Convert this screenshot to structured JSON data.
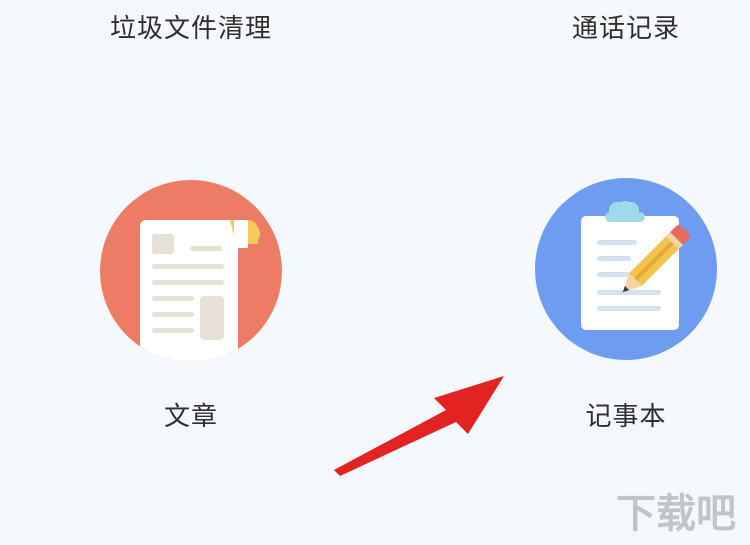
{
  "grid": {
    "items": [
      {
        "label": "垃圾文件清理",
        "icon": "trash-clean-icon"
      },
      {
        "label": "通话记录",
        "icon": "call-log-icon"
      },
      {
        "label": "文章",
        "icon": "article-icon",
        "color": "#ec7c66"
      },
      {
        "label": "记事本",
        "icon": "notepad-icon",
        "color": "#6e9cf0"
      }
    ]
  },
  "annotation": {
    "arrow_color": "#e32222",
    "arrow_target": "记事本"
  },
  "watermark": {
    "text": "下载吧",
    "color": "#b9bcc2"
  }
}
